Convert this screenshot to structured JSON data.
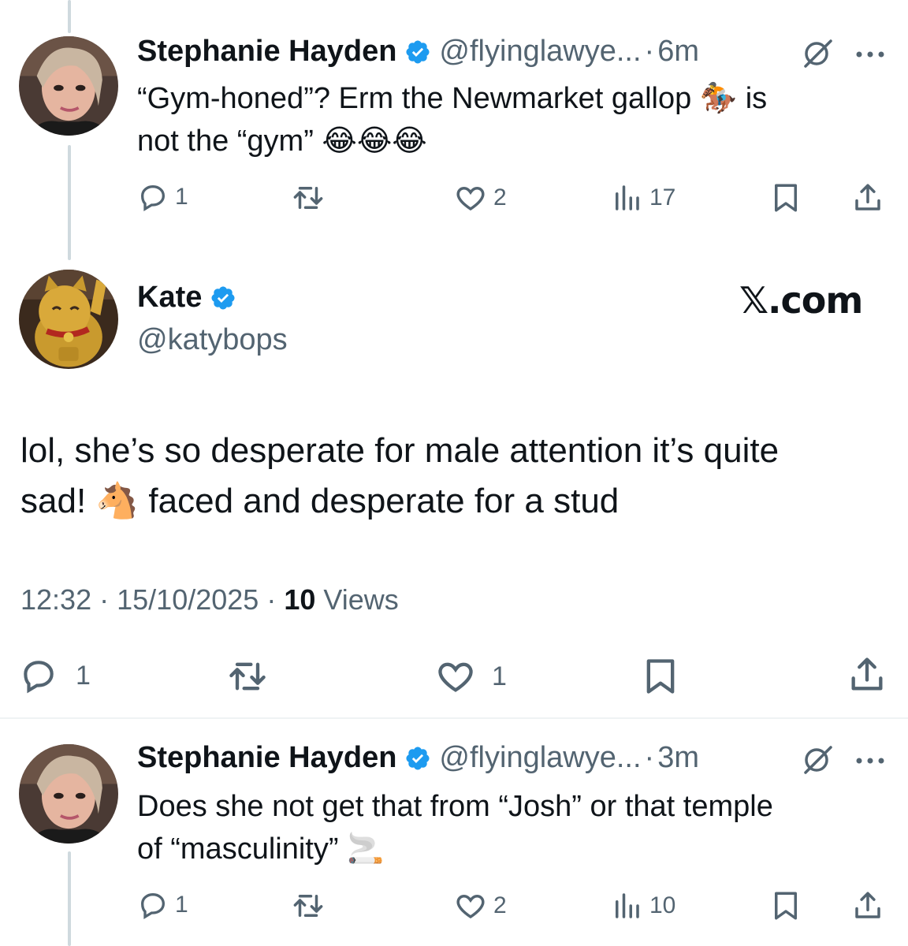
{
  "tweet1": {
    "name": "Stephanie Hayden",
    "handle": "@flyinglawye...",
    "dot": "·",
    "time": "6m",
    "text_line1": "“Gym-honed”? Erm the Newmarket gallop 🏇 is",
    "text_line2": "not the “gym” 😂😂😂",
    "replies": "1",
    "likes": "2",
    "views": "17",
    "avatar_icon": "profile-photo"
  },
  "main_tweet": {
    "name": "Kate",
    "handle": "@katybops",
    "source": "𝕏.com",
    "text_line1": "lol, she’s so desperate for male attention it’s quite",
    "text_line2": "sad! 🐴 faced and desperate for a stud",
    "time": "12:32",
    "date": "15/10/2025",
    "dot": "·",
    "views_count": "10",
    "views_label": "Views",
    "replies": "1",
    "likes": "1",
    "avatar_icon": "lucky-cat-icon"
  },
  "tweet2": {
    "name": "Stephanie Hayden",
    "handle": "@flyinglawye...",
    "dot": "·",
    "time": "3m",
    "text_line1": "Does she not get that from “Josh” or that temple",
    "text_line2": "of “masculinity” 🚬",
    "replies": "1",
    "likes": "2",
    "views": "10",
    "avatar_icon": "profile-photo"
  },
  "colors": {
    "verified": "#1d9bf0",
    "secondary_text": "#536471",
    "primary_text": "#0f1419",
    "thread_line": "#cfd9de"
  }
}
